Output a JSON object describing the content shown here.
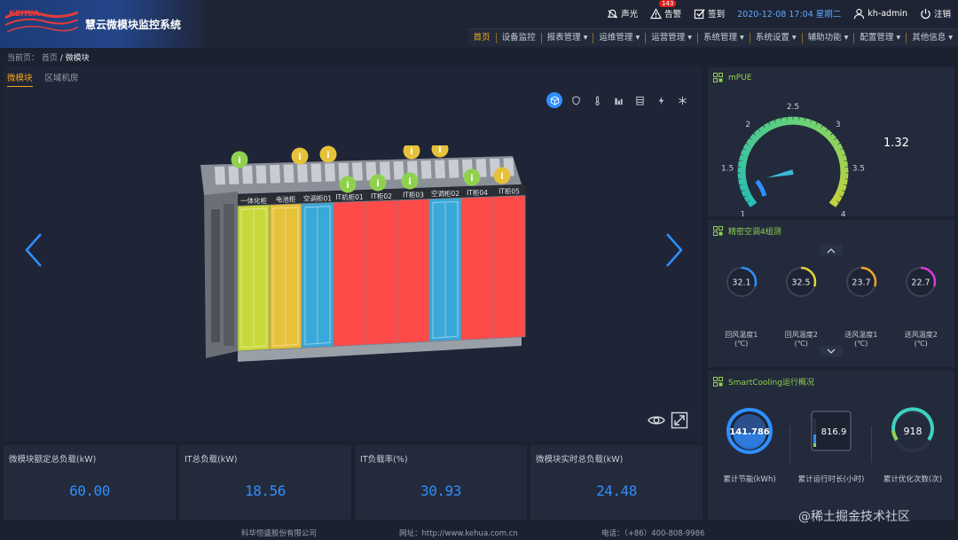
{
  "app": {
    "title": "慧云微模块监控系统"
  },
  "topbar": {
    "sound_label": "声光",
    "alarm_label": "告警",
    "alarm_count": "143",
    "signin_label": "签到",
    "datetime": "2020-12-08 17:04 星期二",
    "user": "kh-admin",
    "logout_label": "注销"
  },
  "nav": {
    "items": [
      "首页",
      "设备监控",
      "报表管理 ▾",
      "运维管理 ▾",
      "运营管理 ▾",
      "系统管理 ▾",
      "系统设置 ▾",
      "辅助功能 ▾",
      "配置管理 ▾",
      "其他信息 ▾"
    ]
  },
  "breadcrumb": {
    "prefix": "当前页：",
    "home": "首页",
    "current": "/ 微模块"
  },
  "tabs": [
    "微模块",
    "区域机房"
  ],
  "scene": {
    "cabinet_labels": [
      "一体化柜",
      "电池柜",
      "空调柜01",
      "IT机柜01",
      "IT柜02",
      "IT柜03",
      "空调柜02",
      "IT柜04",
      "IT柜05"
    ]
  },
  "metrics": [
    {
      "label": "微模块额定总负载(kW)",
      "value": "60.00"
    },
    {
      "label": "IT总负载(kW)",
      "value": "18.56"
    },
    {
      "label": "IT负载率(%)",
      "value": "30.93"
    },
    {
      "label": "微模块实时总负载(kW)",
      "value": "24.48"
    }
  ],
  "mpue": {
    "title": "mPUE",
    "value": "1.32",
    "ticks": [
      "1",
      "1.5",
      "2",
      "2.5",
      "3",
      "3.5",
      "4"
    ],
    "min": 1,
    "max": 4
  },
  "ac": {
    "title": "精密空调4组测",
    "readings": [
      {
        "value": "32.1",
        "label": "回风温度1",
        "unit": "(℃)",
        "color": "#2f8fff",
        "fraction": 0.3
      },
      {
        "value": "32.5",
        "label": "回风温度2",
        "unit": "(℃)",
        "color": "#e6d23a",
        "fraction": 0.3
      },
      {
        "value": "23.7",
        "label": "送风温度1",
        "unit": "(℃)",
        "color": "#f5a623",
        "fraction": 0.3
      },
      {
        "value": "22.7",
        "label": "送风温度2",
        "unit": "(℃)",
        "color": "#d63bd6",
        "fraction": 0.3
      }
    ]
  },
  "smart": {
    "title": "SmartCooling运行概况",
    "energy": {
      "value": "141.786",
      "label": "累计节能(kWh)"
    },
    "runtime": {
      "value": "816.9",
      "label": "累计运行时长(小时)"
    },
    "optimize": {
      "value": "918",
      "label": "累计优化次数(次)"
    }
  },
  "footer": {
    "company": "科华恒盛股份有限公司",
    "website": "网址：http://www.kehua.com.cn",
    "phone": "电话：（+86）400-808-9986",
    "watermark": "@稀土掘金技术社区"
  },
  "colors": {
    "accent": "#f5a623",
    "blue": "#2f8fff",
    "green": "#8fd14f",
    "red": "#ff4a4a"
  }
}
